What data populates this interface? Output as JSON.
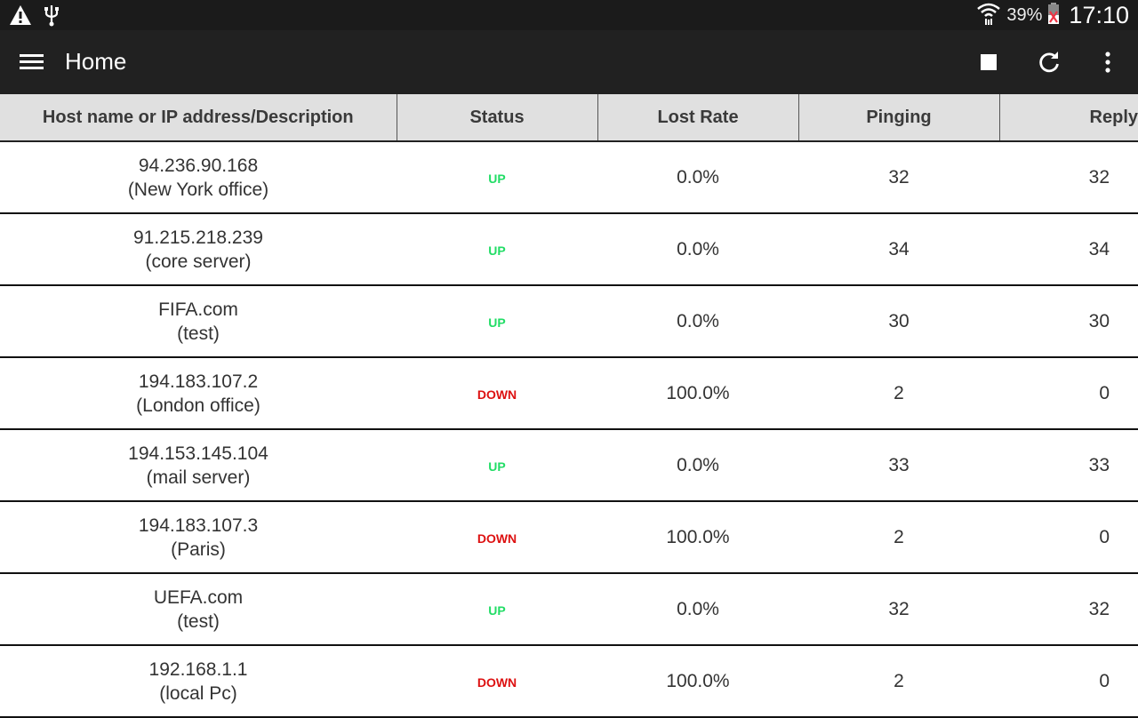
{
  "status_bar": {
    "battery": "39%",
    "time": "17:10",
    "icons": [
      "warning-icon",
      "usb-icon",
      "wifi-icon",
      "battery-icon"
    ]
  },
  "app_bar": {
    "title": "Home",
    "actions": [
      "stop-icon",
      "refresh-icon",
      "overflow-menu-icon"
    ]
  },
  "table": {
    "columns": [
      "Host name or IP address/Description",
      "Status",
      "Lost Rate",
      "Pinging",
      "Reply"
    ],
    "rows": [
      {
        "host": "94.236.90.168",
        "desc": "(New York office)",
        "status": "UP",
        "lost": "0.0%",
        "pinging": "32",
        "reply": "32"
      },
      {
        "host": "91.215.218.239",
        "desc": "(core server)",
        "status": "UP",
        "lost": "0.0%",
        "pinging": "34",
        "reply": "34"
      },
      {
        "host": "FIFA.com",
        "desc": "(test)",
        "status": "UP",
        "lost": "0.0%",
        "pinging": "30",
        "reply": "30"
      },
      {
        "host": "194.183.107.2",
        "desc": "(London office)",
        "status": "DOWN",
        "lost": "100.0%",
        "pinging": "2",
        "reply": "0"
      },
      {
        "host": "194.153.145.104",
        "desc": "(mail server)",
        "status": "UP",
        "lost": "0.0%",
        "pinging": "33",
        "reply": "33"
      },
      {
        "host": "194.183.107.3",
        "desc": "(Paris)",
        "status": "DOWN",
        "lost": "100.0%",
        "pinging": "2",
        "reply": "0"
      },
      {
        "host": "UEFA.com",
        "desc": "(test)",
        "status": "UP",
        "lost": "0.0%",
        "pinging": "32",
        "reply": "32"
      },
      {
        "host": "192.168.1.1",
        "desc": "(local Pc)",
        "status": "DOWN",
        "lost": "100.0%",
        "pinging": "2",
        "reply": "0"
      }
    ]
  },
  "colors": {
    "up": "#22dd66",
    "down": "#dd1111",
    "appbar": "#212121",
    "header_bg": "#e0e0e0"
  }
}
